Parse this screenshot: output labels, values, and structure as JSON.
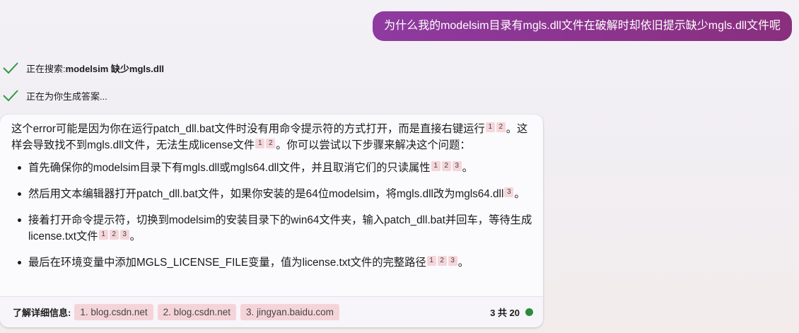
{
  "user_message": "为什么我的modelsim目录有mgls.dll文件在破解时却依旧提示缺少mgls.dll文件呢",
  "status": {
    "searching_prefix": "正在搜索: ",
    "searching_query": "modelsim 缺少mgls.dll",
    "generating": "正在为你生成答案..."
  },
  "answer": {
    "intro_1": "这个error可能是因为你在运行patch_dll.bat文件时没有用命令提示符的方式打开，而是直接右键运行",
    "intro_2": "。这样会导致找不到mgls.dll文件，无法生成license文件",
    "intro_3": "。你可以尝试以下步骤来解决这个问题：",
    "bullet_1": "首先确保你的modelsim目录下有mgls.dll或mgls64.dll文件，并且取消它们的只读属性",
    "bullet_2": "然后用文本编辑器打开patch_dll.bat文件，如果你安装的是64位modelsim，将mgls.dll改为mgls64.dll",
    "bullet_3": "接着打开命令提示符，切换到modelsim的安装目录下的win64文件夹，输入patch_dll.bat并回车，等待生成license.txt文件",
    "bullet_4": "最后在环境变量中添加MGLS_LICENSE_FILE变量，值为license.txt文件的完整路径",
    "period": "。",
    "cite_1": "1",
    "cite_2": "2",
    "cite_3": "3"
  },
  "footer": {
    "label": "了解详细信息:",
    "sources": [
      "1. blog.csdn.net",
      "2. blog.csdn.net",
      "3. jingyan.baidu.com"
    ],
    "count": "3 共 20",
    "status_color": "#2e8b3e"
  },
  "colors": {
    "user_bubble": "#8e3aa0",
    "check": "#2e9a3e",
    "citation_bg": "#f5d6da"
  },
  "icons": [
    "check-icon",
    "status-dot-icon"
  ]
}
